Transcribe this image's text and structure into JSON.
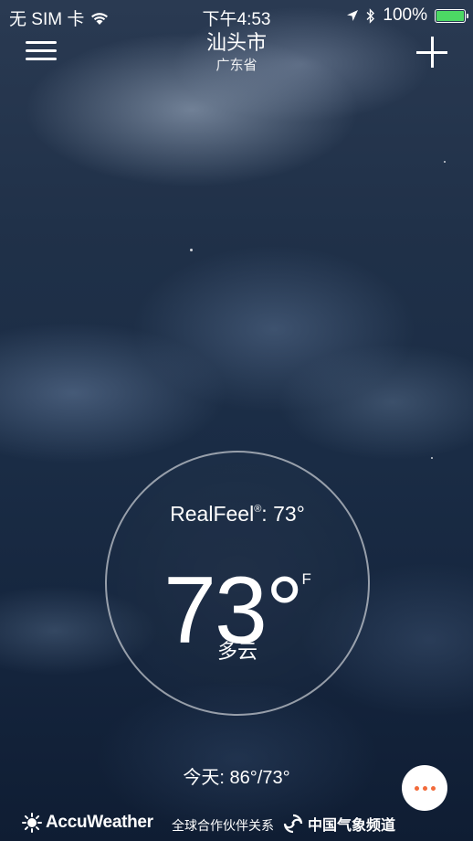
{
  "status_bar": {
    "carrier": "无 SIM 卡",
    "time": "下午4:53",
    "battery_percent": "100%",
    "battery_level": 1.0,
    "battery_color": "#4cd964"
  },
  "header": {
    "menu_icon": "hamburger-menu-icon",
    "add_icon": "plus-icon",
    "city": "汕头市",
    "province": "广东省"
  },
  "current": {
    "realfeel_label": "RealFeel",
    "realfeel_mark": "®",
    "realfeel_value": ": 73°",
    "temperature": "73°",
    "unit": "F",
    "condition": "多云"
  },
  "today": {
    "text": "今天: 86°/73°"
  },
  "more_button": {
    "icon": "more-dots-icon",
    "accent_color": "#f26a3a"
  },
  "footer": {
    "brand": "AccuWeather",
    "partner_text": "全球合作伙伴关系",
    "partner_brand": "中国气象频道"
  }
}
